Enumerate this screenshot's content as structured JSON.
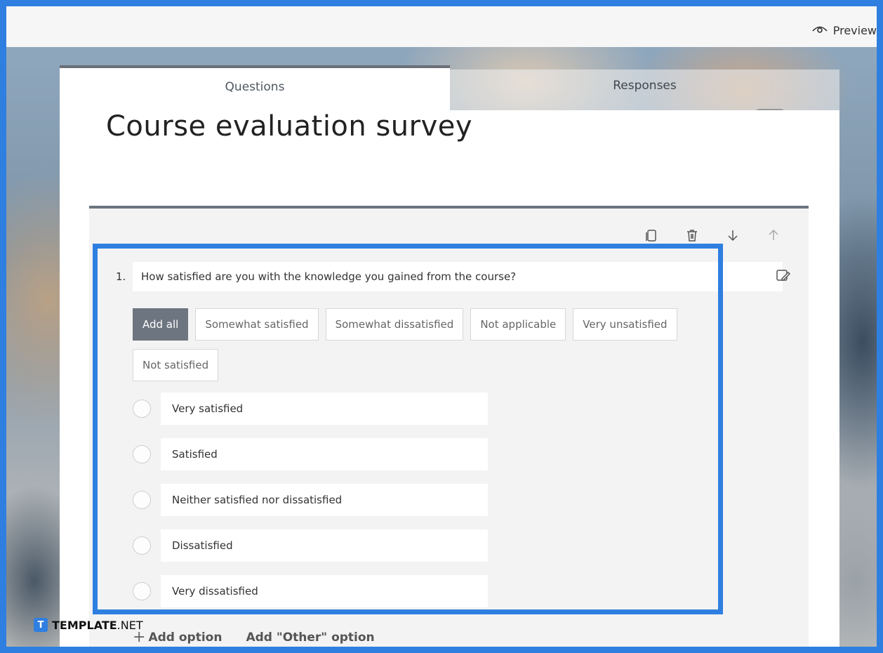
{
  "topbar": {
    "preview_label": "Preview",
    "preview_icon": "eye-icon"
  },
  "tabs": [
    {
      "label": "Questions"
    },
    {
      "label": "Responses"
    }
  ],
  "form": {
    "title": "Course evaluation survey"
  },
  "question": {
    "number": "1.",
    "text": "How satisfied are you with the knowledge you gained from the course?",
    "tools": [
      "copy-icon",
      "trash-icon",
      "arrow-down-icon",
      "arrow-up-icon"
    ],
    "suggestions": [
      "Add all",
      "Somewhat satisfied",
      "Somewhat dissatisfied",
      "Not applicable",
      "Very unsatisfied",
      "Not satisfied"
    ],
    "options": [
      "Very satisfied",
      "Satisfied",
      "Neither satisfied nor dissatisfied",
      "Dissatisfied",
      "Very dissatisfied"
    ]
  },
  "actions": {
    "add_option": "Add option",
    "add_other": "Add \"Other\" option"
  },
  "watermark": {
    "logo_letter": "T",
    "brand": "TEMPLATE",
    "suffix": ".NET"
  },
  "colors": {
    "highlight": "#2f7fe0",
    "chip_primary": "#6c7580"
  }
}
